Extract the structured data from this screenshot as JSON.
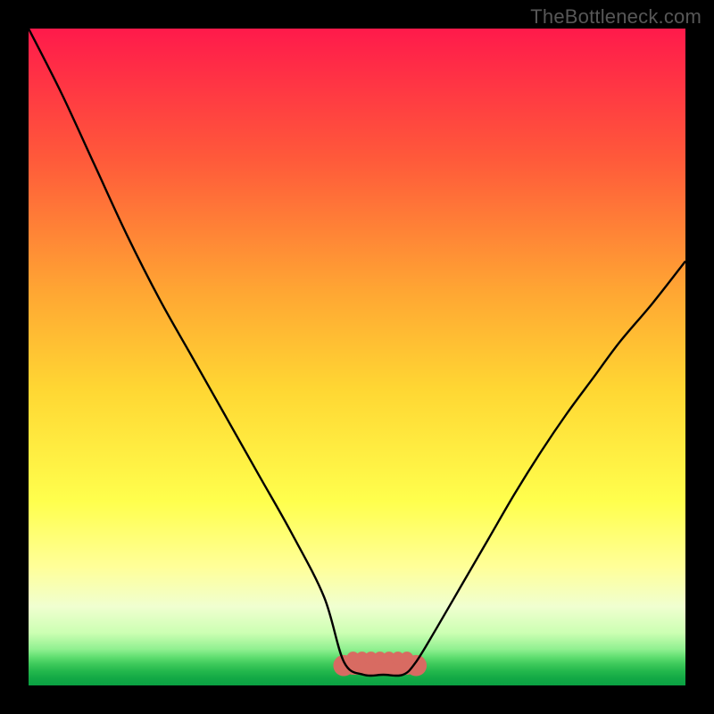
{
  "watermark": "TheBottleneck.com",
  "gradient_stops": [
    {
      "offset": 0.0,
      "color": "#ff1a4b"
    },
    {
      "offset": 0.2,
      "color": "#ff5a3a"
    },
    {
      "offset": 0.4,
      "color": "#ffa633"
    },
    {
      "offset": 0.55,
      "color": "#ffd733"
    },
    {
      "offset": 0.72,
      "color": "#ffff4d"
    },
    {
      "offset": 0.82,
      "color": "#ffff99"
    },
    {
      "offset": 0.88,
      "color": "#f0ffd0"
    },
    {
      "offset": 0.92,
      "color": "#ccffb3"
    },
    {
      "offset": 0.945,
      "color": "#90f090"
    },
    {
      "offset": 0.958,
      "color": "#5cdc6e"
    },
    {
      "offset": 0.968,
      "color": "#3cc85a"
    },
    {
      "offset": 0.978,
      "color": "#24b84d"
    },
    {
      "offset": 0.988,
      "color": "#14aa46"
    },
    {
      "offset": 1.0,
      "color": "#0aa042"
    }
  ],
  "sweet_spot": {
    "x_start": 0.48,
    "x_end": 0.59,
    "height": 0.028
  },
  "sweet_spot_color": "#d86b62",
  "curve_color": "#000000",
  "chart_data": {
    "type": "line",
    "title": "",
    "xlabel": "",
    "ylabel": "",
    "xlim": [
      0,
      1
    ],
    "ylim": [
      0,
      1
    ],
    "series": [
      {
        "name": "bottleneck-curve",
        "x": [
          0.0,
          0.05,
          0.1,
          0.15,
          0.2,
          0.25,
          0.3,
          0.35,
          0.4,
          0.45,
          0.48,
          0.51,
          0.54,
          0.57,
          0.59,
          0.62,
          0.66,
          0.7,
          0.74,
          0.78,
          0.82,
          0.86,
          0.9,
          0.95,
          1.0
        ],
        "y": [
          1.0,
          0.9,
          0.79,
          0.68,
          0.58,
          0.49,
          0.4,
          0.31,
          0.22,
          0.12,
          0.02,
          0.0,
          0.0,
          0.0,
          0.02,
          0.07,
          0.14,
          0.21,
          0.28,
          0.345,
          0.405,
          0.46,
          0.515,
          0.575,
          0.64
        ]
      }
    ]
  }
}
